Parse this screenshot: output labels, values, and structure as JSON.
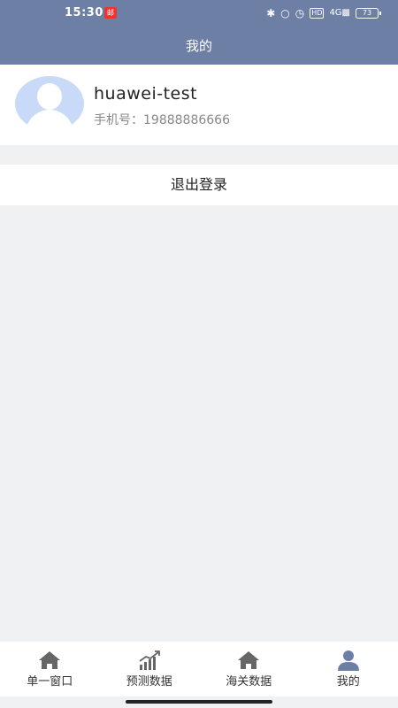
{
  "status_bar": {
    "time": "15:30",
    "badge": "邮",
    "battery": "73"
  },
  "nav": {
    "title": "我的"
  },
  "profile": {
    "username": "huawei-test",
    "phone": "手机号：19888886666"
  },
  "actions": {
    "logout_label": "退出登录"
  },
  "tabs": [
    {
      "label": "单一窗口",
      "icon": "home-icon"
    },
    {
      "label": "预测数据",
      "icon": "chart-icon"
    },
    {
      "label": "海关数据",
      "icon": "home-icon"
    },
    {
      "label": "我的",
      "icon": "user-icon",
      "active": true
    }
  ],
  "colors": {
    "header": "#6e7fa6",
    "active_tab": "#6e7fa6",
    "avatar_bg": "#c8daf8"
  }
}
